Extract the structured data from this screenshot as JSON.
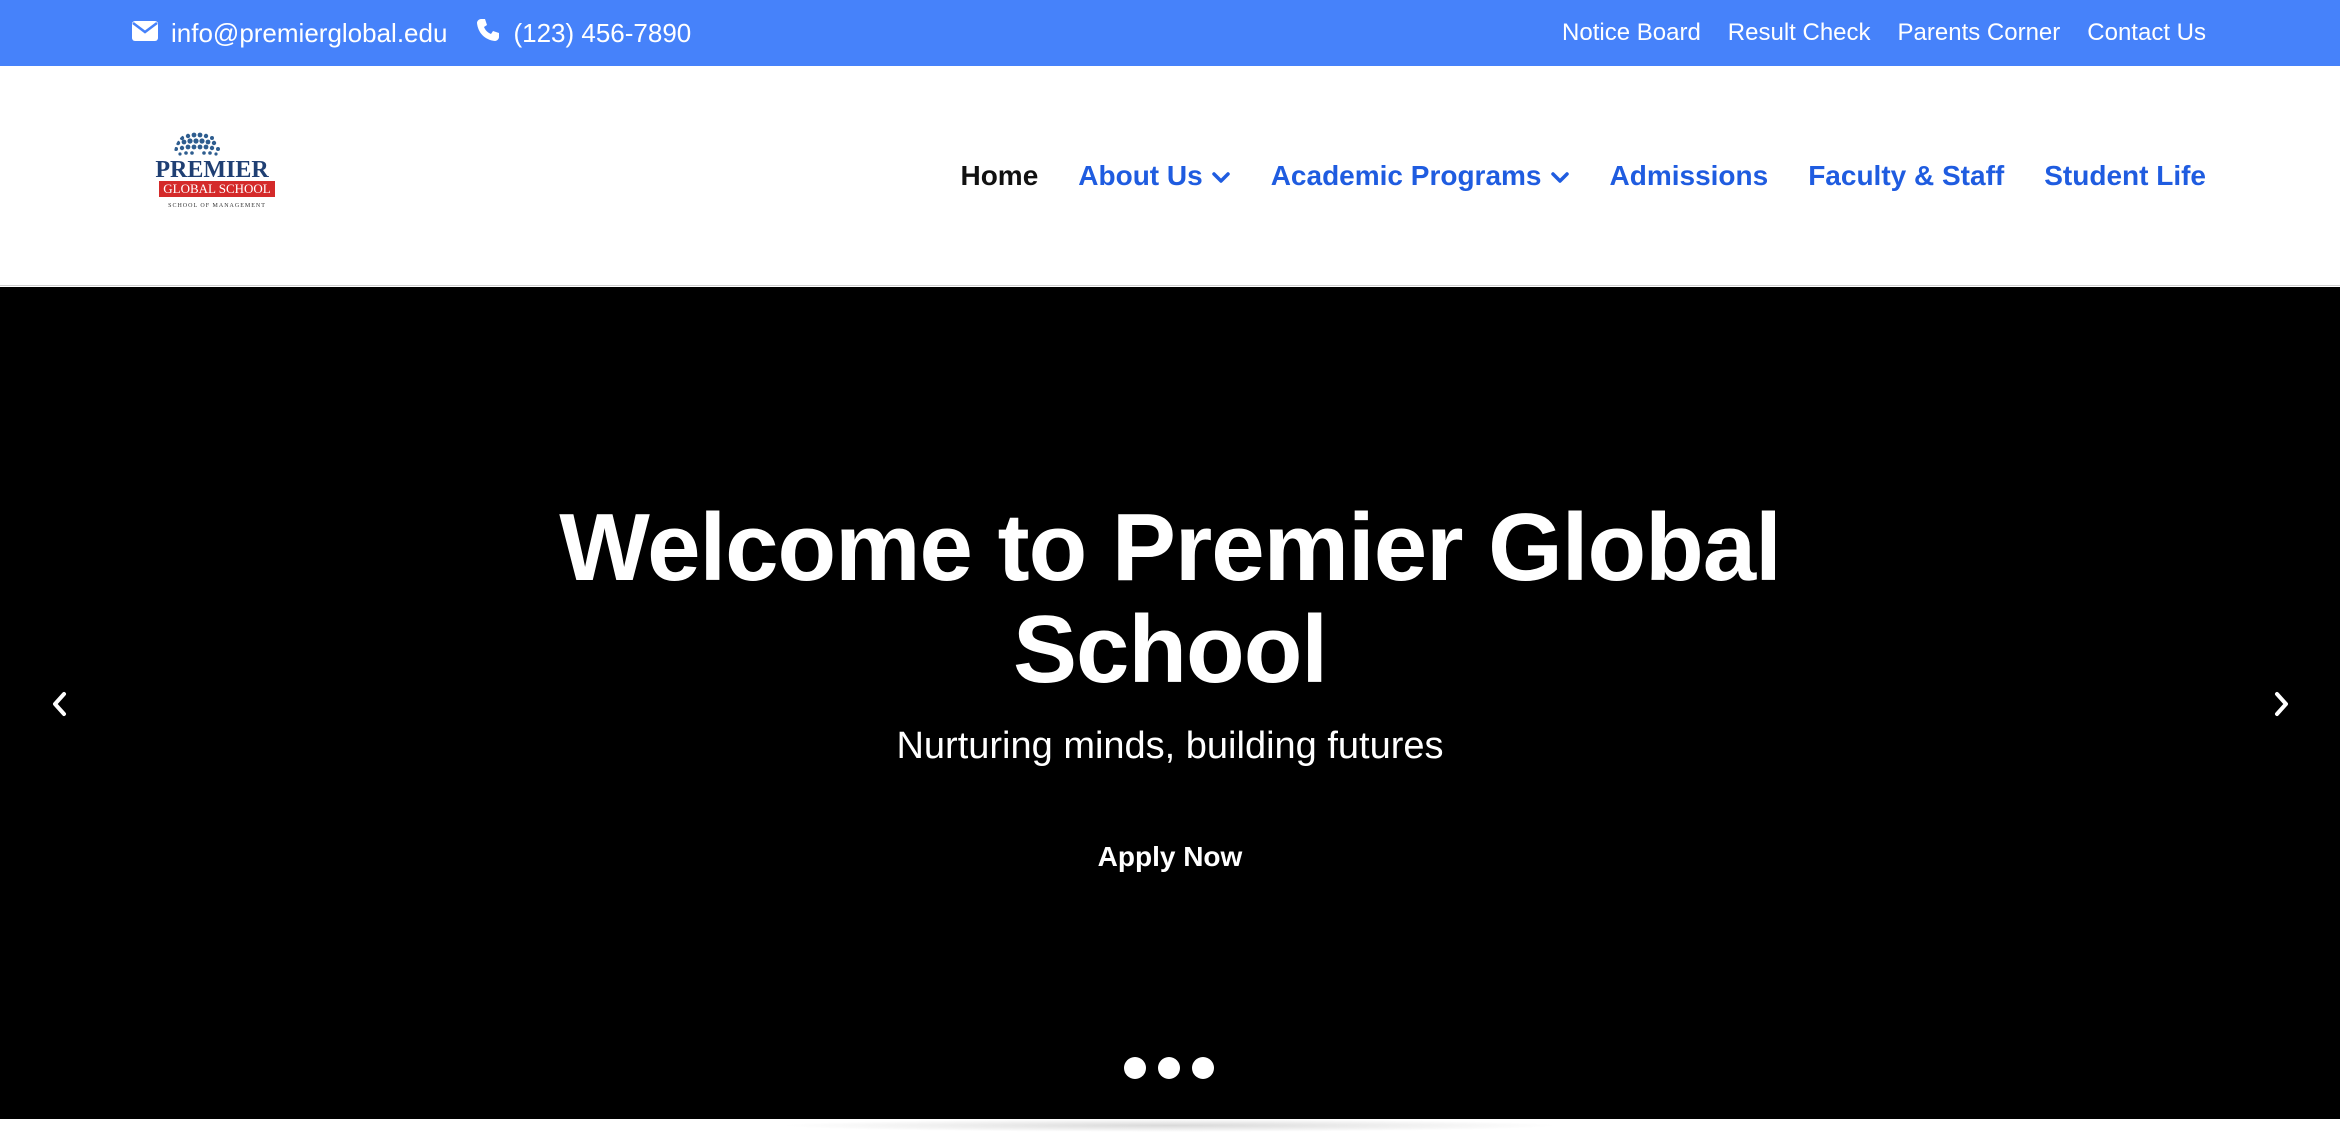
{
  "topbar": {
    "email": "info@premierglobal.edu",
    "phone": "(123) 456-7890",
    "email_icon": "envelope-icon",
    "phone_icon": "phone-icon",
    "links": [
      "Notice Board",
      "Result Check",
      "Parents Corner",
      "Contact Us"
    ],
    "background_color": "#4682fa"
  },
  "logo": {
    "line1": "PREMIER",
    "line2": "GLOBAL SCHOOL",
    "line3": "SCHOOL OF MANAGEMENT"
  },
  "nav": {
    "items": [
      {
        "label": "Home",
        "active": true,
        "dropdown": false
      },
      {
        "label": "About Us",
        "active": false,
        "dropdown": true
      },
      {
        "label": "Academic Programs",
        "active": false,
        "dropdown": true
      },
      {
        "label": "Admissions",
        "active": false,
        "dropdown": false
      },
      {
        "label": "Faculty & Staff",
        "active": false,
        "dropdown": false
      },
      {
        "label": "Student Life",
        "active": false,
        "dropdown": false
      }
    ],
    "link_color": "#1f5ce0"
  },
  "hero": {
    "title": "Welcome to Premier Global School",
    "subtitle": "Nurturing minds, building futures",
    "cta": "Apply Now",
    "prev_icon": "chevron-left-icon",
    "next_icon": "chevron-right-icon",
    "slide_count": 3
  }
}
